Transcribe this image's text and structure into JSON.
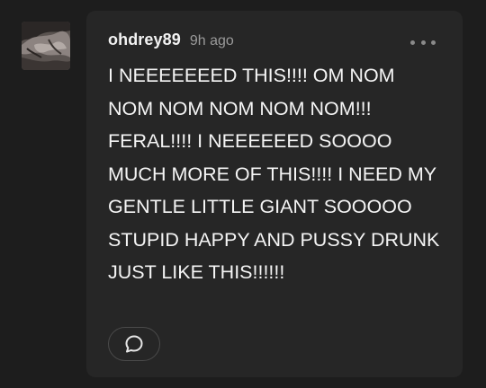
{
  "comment": {
    "username": "ohdrey89",
    "timestamp": "9h ago",
    "text": "I NEEEEEEED THIS!!!! OM NOM NOM NOM NOM NOM NOM!!! FERAL!!!! I NEEEEEED SOOOO MUCH MORE OF THIS!!!! I NEED MY GENTLE LITTLE GIANT SOOOOO STUPID HAPPY AND PUSSY DRUNK JUST LIKE THIS!!!!!!"
  },
  "icons": {
    "more": "more-horizontal-icon",
    "reply": "speech-bubble-icon"
  },
  "colors": {
    "background": "#1d1d1d",
    "card": "#262626",
    "text": "#f5f5f5",
    "muted": "#9a9a9a"
  }
}
